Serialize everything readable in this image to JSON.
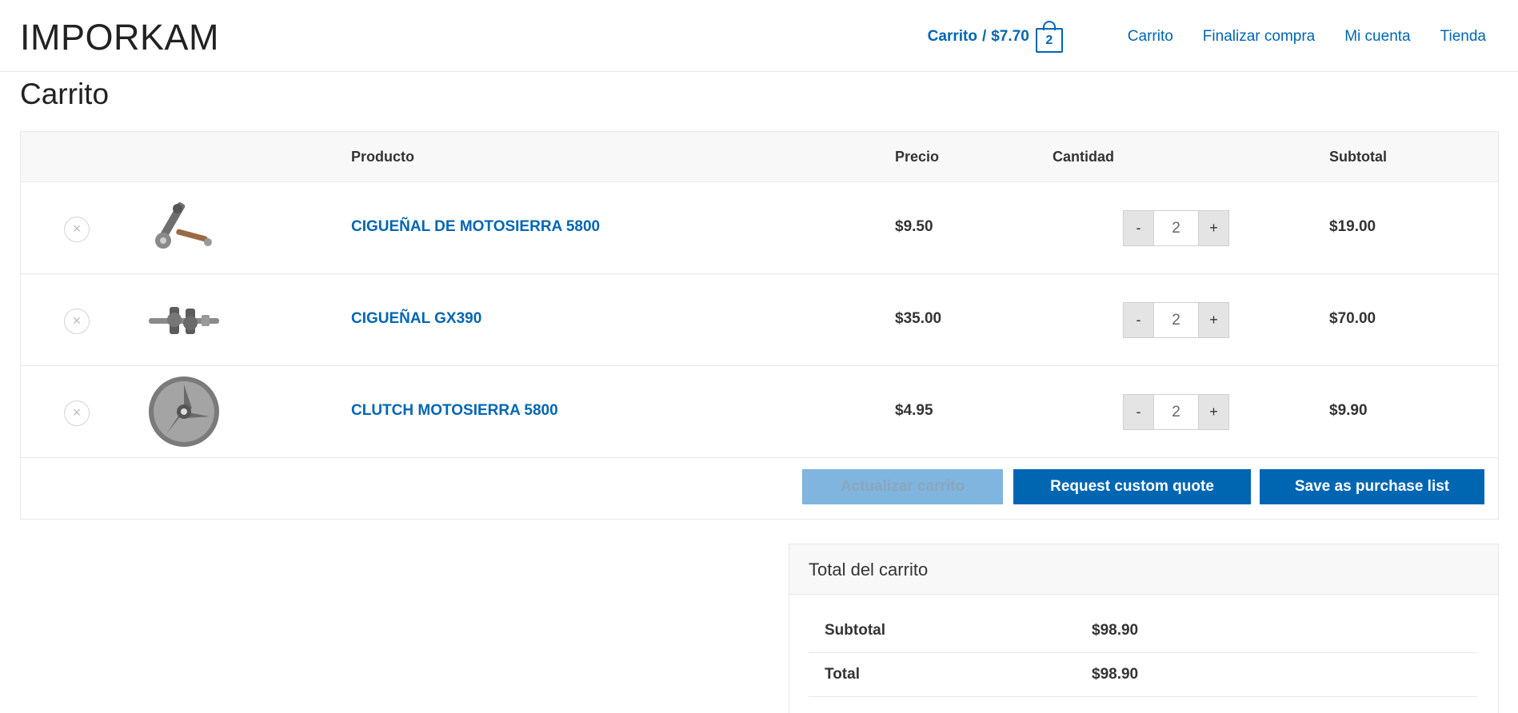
{
  "header": {
    "logo": "IMPORKAM",
    "cart_label": "Carrito",
    "cart_separator": "/",
    "cart_total": "$7.70",
    "cart_count": "2",
    "nav": [
      "Carrito",
      "Finalizar compra",
      "Mi cuenta",
      "Tienda"
    ]
  },
  "page": {
    "title": "Carrito"
  },
  "table": {
    "headers": {
      "product": "Producto",
      "price": "Precio",
      "quantity": "Cantidad",
      "subtotal": "Subtotal"
    },
    "rows": [
      {
        "name": "CIGUEÑAL DE MOTOSIERRA 5800",
        "price": "$9.50",
        "qty": "2",
        "subtotal": "$19.00",
        "image": "crankshaft-icon"
      },
      {
        "name": "CIGUEÑAL GX390",
        "price": "$35.00",
        "qty": "2",
        "subtotal": "$70.00",
        "image": "crankshaft-icon"
      },
      {
        "name": "CLUTCH MOTOSIERRA 5800",
        "price": "$4.95",
        "qty": "2",
        "subtotal": "$9.90",
        "image": "clutch-icon"
      }
    ],
    "remove_symbol": "×",
    "minus": "-",
    "plus": "+"
  },
  "actions": {
    "update": "Actualizar carrito",
    "quote": "Request custom quote",
    "save": "Save as purchase list"
  },
  "totals": {
    "title": "Total del carrito",
    "subtotal_label": "Subtotal",
    "subtotal_value": "$98.90",
    "total_label": "Total",
    "total_value": "$98.90"
  },
  "colors": {
    "accent": "#0066b2",
    "disabled": "#7fb5de"
  }
}
